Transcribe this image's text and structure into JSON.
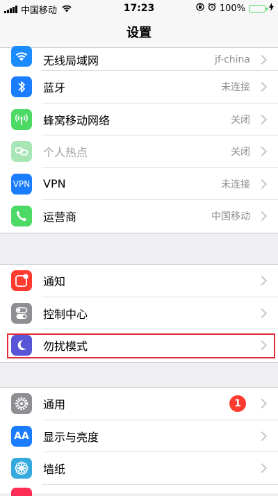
{
  "status_bar": {
    "carrier": "中国移动",
    "time": "17:23",
    "battery": "100%"
  },
  "nav": {
    "title": "设置"
  },
  "group1": [
    {
      "label": "无线局域网",
      "value": "jf-china",
      "icon": "wifi-icon",
      "color": "#1a8cff"
    },
    {
      "label": "蓝牙",
      "value": "未连接",
      "icon": "bluetooth-icon",
      "color": "#1a7dff"
    },
    {
      "label": "蜂窝移动网络",
      "value": "关闭",
      "icon": "cellular-icon",
      "color": "#4cd964"
    },
    {
      "label": "个人热点",
      "value": "关闭",
      "icon": "hotspot-icon",
      "color": "#a8e6b5"
    },
    {
      "label": "VPN",
      "value": "未连接",
      "icon": "vpn-icon",
      "icon_text": "VPN",
      "color": "#1a7dff"
    },
    {
      "label": "运营商",
      "value": "中国移动",
      "icon": "phone-icon",
      "color": "#4cd964"
    }
  ],
  "group2": [
    {
      "label": "通知",
      "icon": "notifications-icon",
      "color": "#ff3b30"
    },
    {
      "label": "控制中心",
      "icon": "control-center-icon",
      "color": "#8e8e93"
    },
    {
      "label": "勿扰模式",
      "icon": "moon-icon",
      "color": "#5856d6"
    }
  ],
  "group3": [
    {
      "label": "通用",
      "badge": "1",
      "icon": "gear-icon",
      "color": "#8e8e93"
    },
    {
      "label": "显示与亮度",
      "icon": "display-icon",
      "icon_text": "AA",
      "color": "#1a7dff"
    },
    {
      "label": "墙纸",
      "icon": "wallpaper-icon",
      "color": "#36aadc"
    }
  ],
  "colors": {
    "background": "#efeff4",
    "highlight": "#e12b37",
    "partial_row_icon": "#ff2d55"
  }
}
